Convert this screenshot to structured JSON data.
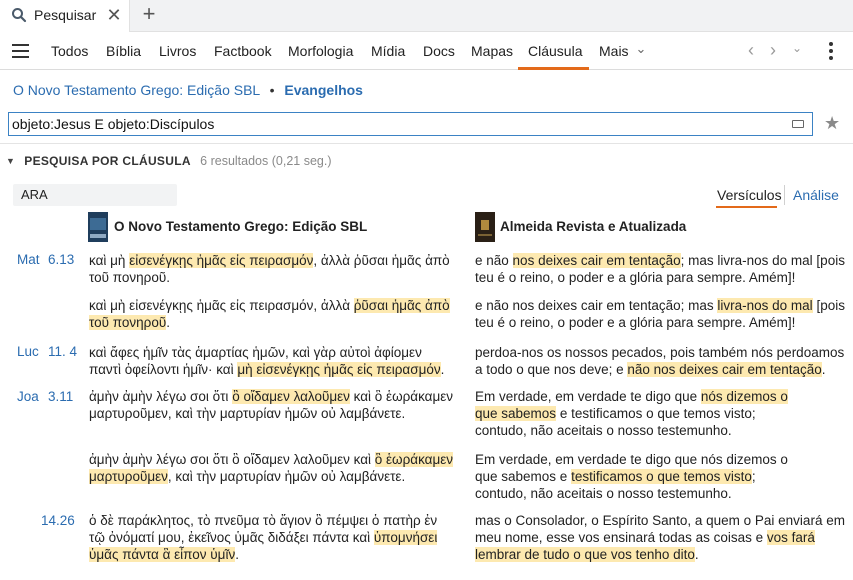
{
  "tabstrip": {
    "tab_label": "Pesquisar",
    "close_symbol": "✕",
    "add_symbol": "+"
  },
  "menu": {
    "items": [
      "Todos",
      "Bíblia",
      "Livros",
      "Factbook",
      "Morfologia",
      "Mídia",
      "Docs",
      "Mapas",
      "Cláusula",
      "Mais"
    ],
    "active": "Cláusula",
    "more_caret": "⌄",
    "back_arrow": "‹",
    "forward_arrow": "›",
    "dropdown_caret": "⌄"
  },
  "breadcrumb": {
    "resource": "O Novo Testamento Grego: Edição SBL",
    "separator": "•",
    "scope": "Evangelhos"
  },
  "search": {
    "value": "objeto:Jesus E objeto:Discípulos",
    "star_symbol": "★"
  },
  "section": {
    "caret": "▼",
    "title": "PESQUISA POR CLÁUSULA",
    "count": "6 resultados (0,21 seg.)"
  },
  "version_box": "ARA",
  "views": {
    "verses": "Versículos",
    "analysis": "Análise"
  },
  "columns": {
    "left": "O Novo Testamento Grego: Edição SBL",
    "right": "Almeida Revista e Atualizada"
  },
  "colors": {
    "accent": "#e36a1a",
    "link": "#2b6cb0",
    "highlight": "#fde9b0"
  },
  "results": [
    {
      "book": "Mat",
      "ref": "6.13",
      "greek": [
        [
          "καὶ μὴ ",
          0
        ],
        [
          "εἰσενέγκῃς ἡμᾶς εἰς πειρασμόν",
          1
        ],
        [
          ", ἀλλὰ ῥῦσαι ἡμᾶς ἀπὸ τοῦ πονηροῦ.",
          0
        ]
      ],
      "portuguese": [
        [
          "e não ",
          0
        ],
        [
          "nos deixes cair em tentação",
          1
        ],
        [
          "; mas livra-nos do mal [pois teu é o reino, o poder e a glória para sempre. Amém]!",
          0
        ]
      ]
    },
    {
      "book": "",
      "ref": "",
      "greek": [
        [
          "καὶ μὴ εἰσενέγκῃς ἡμᾶς εἰς πειρασμόν, ἀλλὰ ",
          0
        ],
        [
          "ῥῦσαι ἡμᾶς ἀπὸ τοῦ πονηροῦ",
          1
        ],
        [
          ".",
          0
        ]
      ],
      "portuguese": [
        [
          "e não nos deixes cair em tentação; mas ",
          0
        ],
        [
          "livra-nos do mal",
          1
        ],
        [
          " [pois teu é o reino, o poder e a glória para sempre. Amém]!",
          0
        ]
      ]
    },
    {
      "book": "Luc",
      "ref": "11. 4",
      "greek": [
        [
          "καὶ ἄφες ἡμῖν τὰς ἁμαρτίας ἡμῶν, καὶ γὰρ αὐτοὶ ἀφίομεν παντὶ ὀφείλοντι ἡμῖν· καὶ ",
          0
        ],
        [
          "μὴ εἰσενέγκῃς ἡμᾶς εἰς πειρασμόν",
          1
        ],
        [
          ".",
          0
        ]
      ],
      "portuguese": [
        [
          "perdoa-nos os nossos pecados, pois também nós perdoamos a todo o que nos deve; e ",
          0
        ],
        [
          "não nos deixes cair em tentação",
          1
        ],
        [
          ".",
          0
        ]
      ]
    },
    {
      "book": "Joa",
      "ref": "3.11",
      "greek": [
        [
          "ἀμὴν ἀμὴν λέγω σοι ὅτι ",
          0
        ],
        [
          "ὃ οἴδαμεν λαλοῦμεν",
          1
        ],
        [
          " καὶ ὃ ἑωράκαμεν μαρτυροῦμεν, καὶ τὴν μαρτυρίαν ἡμῶν οὐ λαμβάνετε.",
          0
        ]
      ],
      "portuguese": [
        [
          "Em verdade, em verdade te digo que ",
          0
        ],
        [
          "nós dizemos o que sabemos",
          1
        ],
        [
          " e testificamos o que temos visto; contudo, não aceitais o nosso testemunho.",
          0
        ]
      ]
    },
    {
      "book": "",
      "ref": "",
      "greek": [
        [
          "ἀμὴν ἀμὴν λέγω σοι ὅτι ὃ οἴδαμεν λαλοῦμεν καὶ ",
          0
        ],
        [
          "ὃ ἑωράκαμεν μαρτυροῦμεν",
          1
        ],
        [
          ", καὶ τὴν μαρτυρίαν ἡμῶν οὐ λαμβάνετε.",
          0
        ]
      ],
      "portuguese": [
        [
          "Em verdade, em verdade te digo que nós dizemos o que sabemos e ",
          0
        ],
        [
          "testificamos o que temos visto",
          1
        ],
        [
          "; contudo, não aceitais o nosso testemunho.",
          0
        ]
      ]
    },
    {
      "book": "",
      "ref": "14.26",
      "greek": [
        [
          "ὁ δὲ παράκλητος, τὸ πνεῦμα τὸ ἅγιον ὃ πέμψει ὁ πατὴρ ἐν τῷ ὀνόματί μου, ἐκεῖνος ὑμᾶς διδάξει πάντα καὶ ",
          0
        ],
        [
          "ὑπομνήσει ὑμᾶς πάντα ἃ εἶπον ὑμῖν",
          1
        ],
        [
          ".",
          0
        ]
      ],
      "portuguese": [
        [
          "mas o Consolador, o Espírito Santo, a quem o Pai enviará em meu nome, esse vos ensinará todas as coisas e ",
          0
        ],
        [
          "vos fará lembrar de tudo o que vos tenho dito",
          1
        ],
        [
          ".",
          0
        ]
      ]
    }
  ]
}
